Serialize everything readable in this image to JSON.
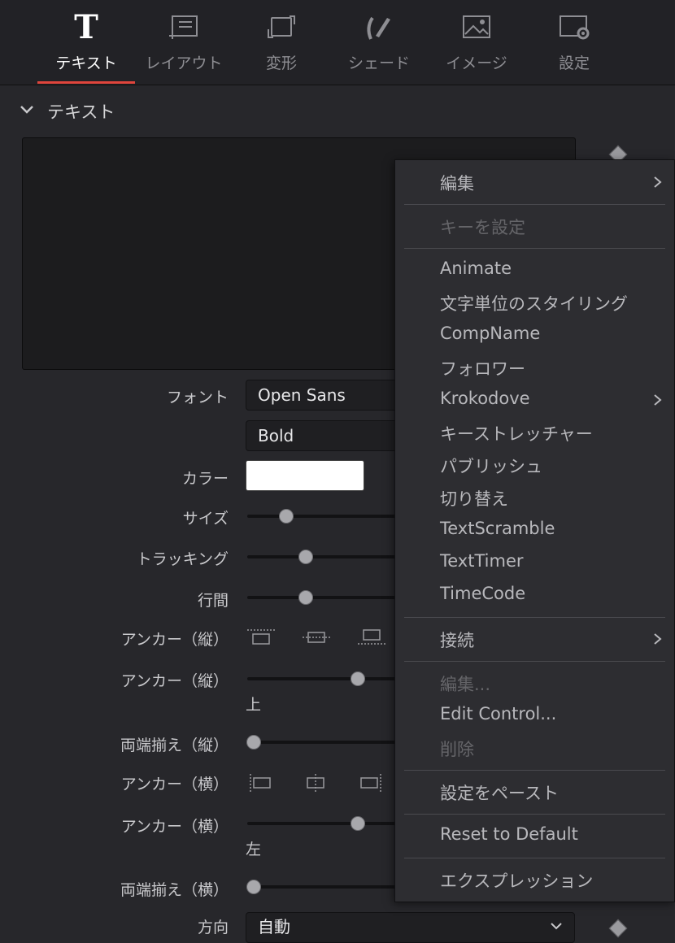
{
  "tabs": [
    {
      "label": "テキスト",
      "icon": "text-t-icon",
      "active": true
    },
    {
      "label": "レイアウト",
      "icon": "layout-icon",
      "active": false
    },
    {
      "label": "変形",
      "icon": "transform-icon",
      "active": false
    },
    {
      "label": "シェード",
      "icon": "shade-brush-icon",
      "active": false
    },
    {
      "label": "イメージ",
      "icon": "image-icon",
      "active": false
    },
    {
      "label": "設定",
      "icon": "settings-icon",
      "active": false
    }
  ],
  "tab_icon_glyph": "T",
  "section": {
    "title": "テキスト"
  },
  "font": {
    "label": "フォント",
    "family": "Open Sans",
    "style": "Bold"
  },
  "color": {
    "label": "カラー",
    "value": "#ffffff"
  },
  "rows": {
    "size": "サイズ",
    "tracking": "トラッキング",
    "line_spacing": "行間",
    "anchor_v_buttons": "アンカー（縦）",
    "anchor_v_slider": "アンカー（縦）",
    "anchor_v_value": "上",
    "justify_v": "両端揃え（縦）",
    "anchor_h_buttons": "アンカー（横）",
    "anchor_h_slider": "アンカー（横）",
    "anchor_h_value": "左",
    "justify_h": "両端揃え（横）",
    "direction": "方向",
    "direction_value": "自動"
  },
  "menu": {
    "items": [
      {
        "label": "編集",
        "disabled": false,
        "submenu": true
      },
      {
        "label": "キーを設定",
        "disabled": true,
        "submenu": false
      },
      {
        "label": "Animate",
        "disabled": false,
        "submenu": false
      },
      {
        "label": "文字単位のスタイリング",
        "disabled": false,
        "submenu": false
      },
      {
        "label": "CompName",
        "disabled": false,
        "submenu": false
      },
      {
        "label": "フォロワー",
        "disabled": false,
        "submenu": false
      },
      {
        "label": "Krokodove",
        "disabled": false,
        "submenu": true
      },
      {
        "label": "キーストレッチャー",
        "disabled": false,
        "submenu": false
      },
      {
        "label": "パブリッシュ",
        "disabled": false,
        "submenu": false
      },
      {
        "label": "切り替え",
        "disabled": false,
        "submenu": false
      },
      {
        "label": "TextScramble",
        "disabled": false,
        "submenu": false
      },
      {
        "label": "TextTimer",
        "disabled": false,
        "submenu": false
      },
      {
        "label": "TimeCode",
        "disabled": false,
        "submenu": false
      },
      {
        "label": "接続",
        "disabled": false,
        "submenu": true
      },
      {
        "label": "編集...",
        "disabled": true,
        "submenu": false
      },
      {
        "label": "Edit Control...",
        "disabled": false,
        "submenu": false
      },
      {
        "label": "削除",
        "disabled": true,
        "submenu": false
      },
      {
        "label": "設定をペースト",
        "disabled": false,
        "submenu": false
      },
      {
        "label": "Reset to Default",
        "disabled": false,
        "submenu": false
      },
      {
        "label": "エクスプレッション",
        "disabled": false,
        "submenu": false
      }
    ]
  },
  "colors": {
    "accent": "#e0453c",
    "panel": "#27272b",
    "menu": "#2d2d31"
  }
}
